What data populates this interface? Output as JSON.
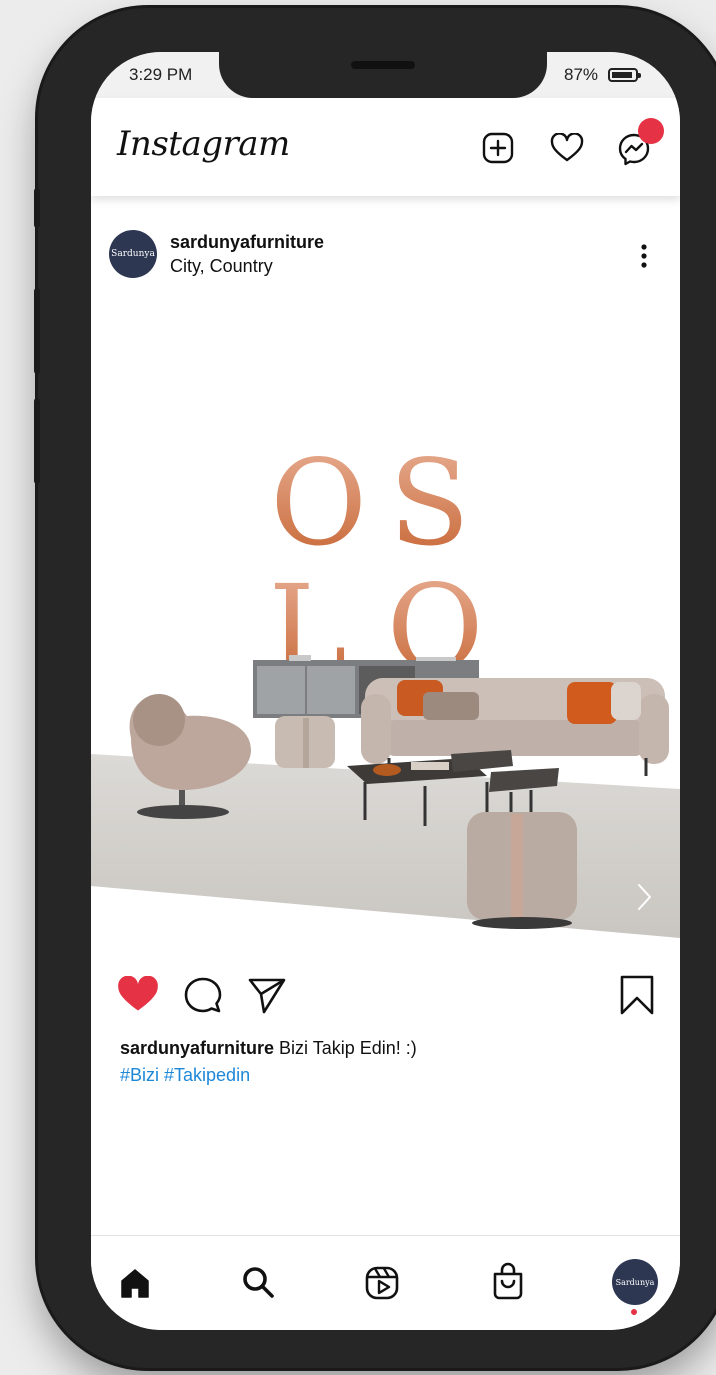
{
  "status_bar": {
    "time": "3:29 PM",
    "battery_percent": "87%"
  },
  "app": {
    "name": "Instagram"
  },
  "post": {
    "username": "sardunyafurniture",
    "location": "City, Country",
    "avatar_text": "Sardunya",
    "image_text_line1": "OS",
    "image_text_line2": "LO",
    "liked": true,
    "caption_user": "sardunyafurniture",
    "caption_text": "Bizi Takip Edin! :)",
    "hashtags": "#Bizi #Takipedin"
  },
  "bottom_nav": {
    "items": [
      "home",
      "search",
      "reels",
      "shop",
      "profile"
    ],
    "profile_avatar_text": "Sardunya"
  },
  "colors": {
    "like_red": "#e53345",
    "hashtag_blue": "#1e88d8",
    "avatar_navy": "#2d3752",
    "oslo_copper": "#c8744a"
  },
  "icons": {
    "appbar": [
      "plus-square-icon",
      "heart-icon",
      "messenger-icon"
    ],
    "post_actions": [
      "heart-filled-icon",
      "comment-icon",
      "share-icon",
      "bookmark-icon"
    ]
  }
}
